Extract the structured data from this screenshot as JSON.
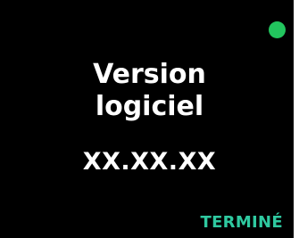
{
  "screen": {
    "title_line1": "Version",
    "title_line2": "logiciel",
    "version_value": "XX.XX.XX",
    "done_label": "TERMINÉ"
  },
  "colors": {
    "background": "#000000",
    "text": "#ffffff",
    "status_dot": "#22c55e",
    "accent": "#2fc9a0"
  },
  "icons": {
    "status": "status-indicator-dot"
  }
}
